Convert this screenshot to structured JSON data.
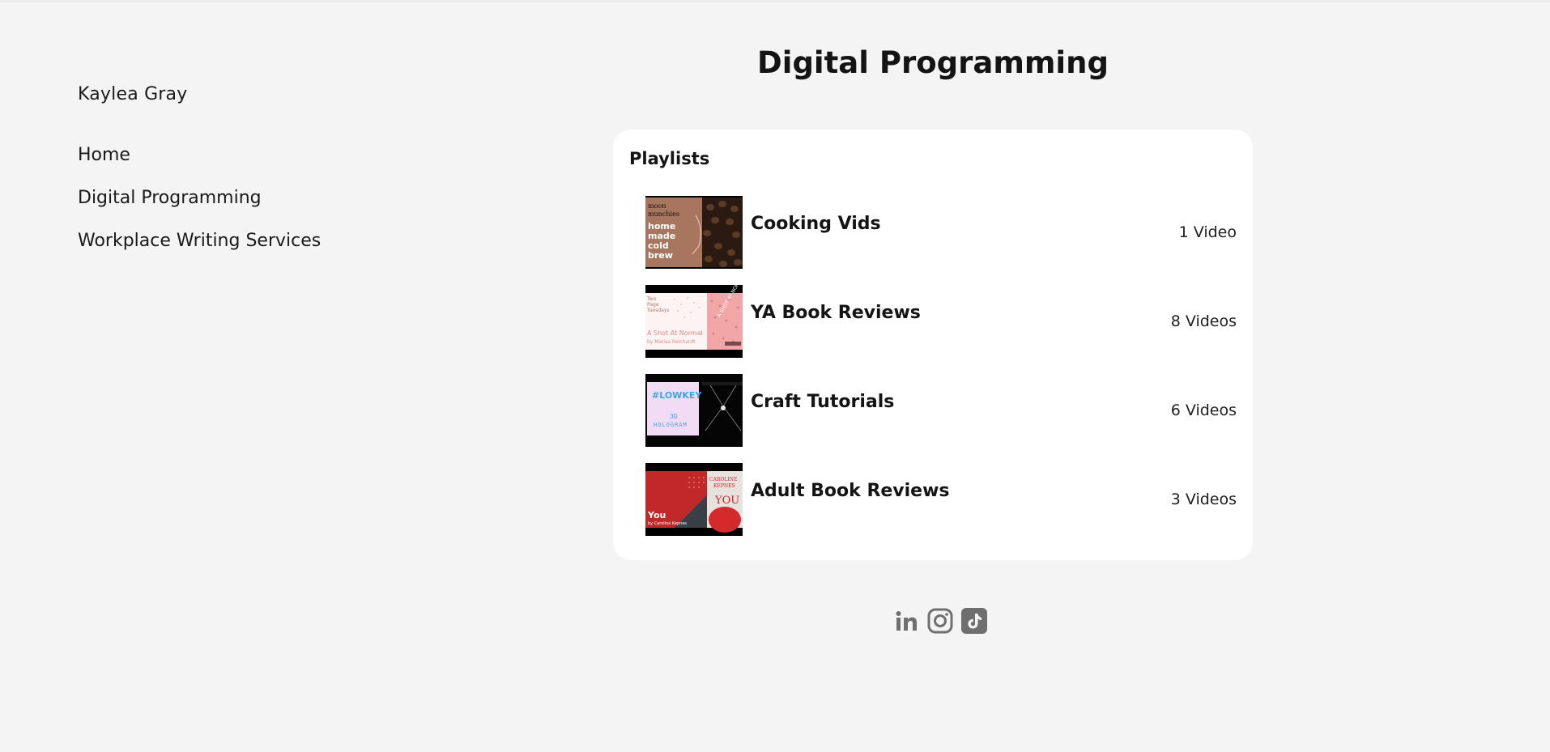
{
  "sidebar": {
    "site_name": "Kaylea Gray",
    "nav": [
      {
        "label": "Home"
      },
      {
        "label": "Digital Programming"
      },
      {
        "label": "Workplace Writing Services"
      }
    ]
  },
  "main": {
    "title": "Digital Programming",
    "playlists_heading": "Playlists",
    "playlists": [
      {
        "title": "Cooking Vids",
        "count": "1 Video",
        "thumb_text": [
          "moon",
          "munchies",
          "home",
          "made",
          "cold",
          "brew"
        ],
        "thumb_icon": "coffee-beans-thumbnail"
      },
      {
        "title": "YA Book Reviews",
        "count": "8 Videos",
        "thumb_text": [
          "Two",
          "Page",
          "Tuesdays",
          "A Shot At Normal",
          "by Marisa Reichardt"
        ],
        "thumb_icon": "book-review-thumbnail"
      },
      {
        "title": "Craft Tutorials",
        "count": "6 Videos",
        "thumb_text": [
          "#LOWKEY",
          "3D",
          "HOLOGRAM"
        ],
        "thumb_icon": "hologram-thumbnail"
      },
      {
        "title": "Adult Book Reviews",
        "count": "3 Videos",
        "thumb_text": [
          "You",
          "by Caroline Kepnes",
          "CAROLINE",
          "KEPNES",
          "YOU"
        ],
        "thumb_icon": "book-review-thumbnail"
      }
    ]
  },
  "footer": {
    "socials": [
      {
        "icon": "linkedin-icon",
        "glyph": "in"
      },
      {
        "icon": "instagram-icon"
      },
      {
        "icon": "tiktok-icon"
      }
    ]
  },
  "colors": {
    "background": "#f4f4f4",
    "card": "#ffffff",
    "text": "#1a1a1a",
    "social_icon": "#6f6f6f"
  }
}
